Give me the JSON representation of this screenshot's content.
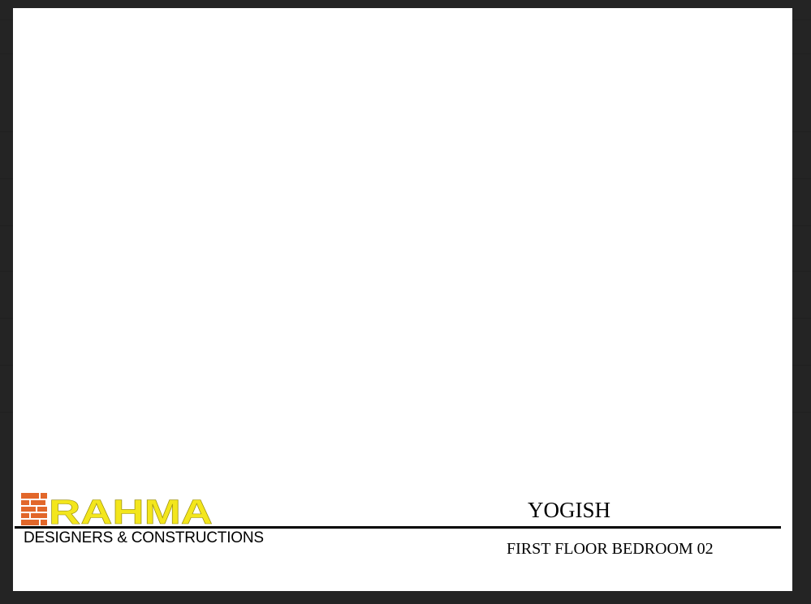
{
  "drawing": {
    "logo_text": "RAHMA",
    "company_name": "DESIGNERS & CONSTRUCTIONS",
    "client_name": "YOGISH",
    "drawing_title": "FIRST FLOOR BEDROOM 02"
  },
  "colors": {
    "logo_orange": "#e2672a",
    "logo_yellow": "#f3e61c",
    "overlay": "#000000",
    "sheet": "#ffffff"
  }
}
